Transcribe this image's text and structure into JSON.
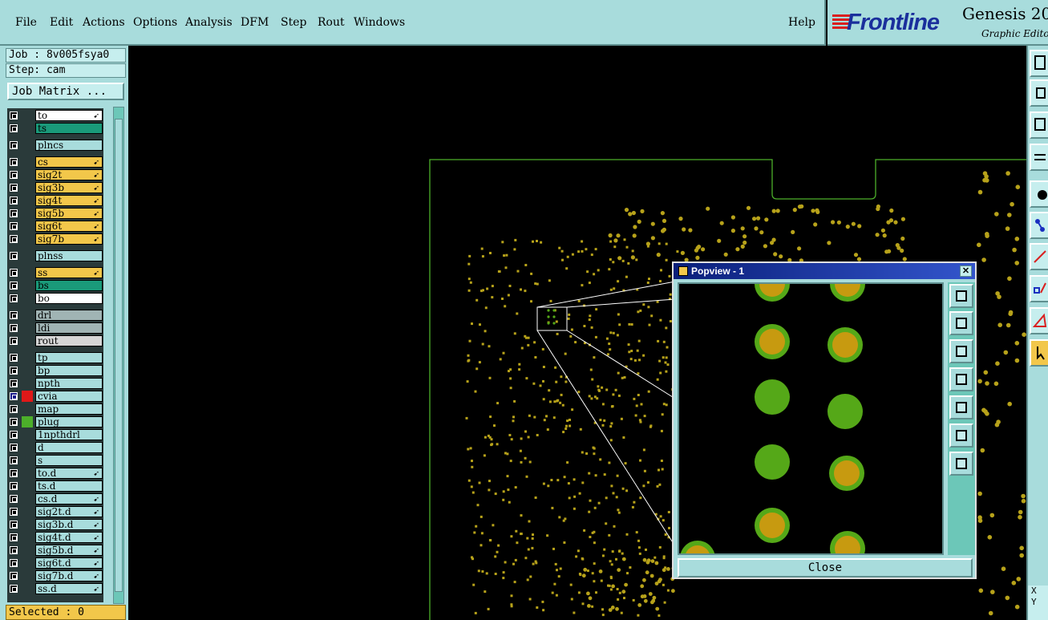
{
  "menu": [
    "File",
    "Edit",
    "Actions",
    "Options",
    "Analysis",
    "DFM",
    "Step",
    "Rout",
    "Windows"
  ],
  "help": "Help",
  "brand": {
    "name": "Frontline",
    "product": "Genesis 20",
    "subtitle": "Graphic Editor"
  },
  "job": "Job : 8v005fsya0",
  "step": "Step: cam",
  "job_matrix_label": "Job Matrix ...",
  "layers": [
    {
      "name": "to",
      "color": "#ffffff",
      "arrow": true
    },
    {
      "name": "ts",
      "color": "#1a9a7a",
      "arrow": false
    },
    {
      "name": "plncs",
      "color": "#a8dcdc",
      "arrow": false
    },
    {
      "name": "cs",
      "color": "#f2c74a",
      "arrow": true
    },
    {
      "name": "sig2t",
      "color": "#f2c74a",
      "arrow": true
    },
    {
      "name": "sig3b",
      "color": "#f2c74a",
      "arrow": true
    },
    {
      "name": "sig4t",
      "color": "#f2c74a",
      "arrow": true
    },
    {
      "name": "sig5b",
      "color": "#f2c74a",
      "arrow": true
    },
    {
      "name": "sig6t",
      "color": "#f2c74a",
      "arrow": true
    },
    {
      "name": "sig7b",
      "color": "#f2c74a",
      "arrow": true
    },
    {
      "name": "plnss",
      "color": "#a8dcdc",
      "arrow": false
    },
    {
      "name": "ss",
      "color": "#f2c74a",
      "arrow": true
    },
    {
      "name": "bs",
      "color": "#1a9a7a",
      "arrow": false
    },
    {
      "name": "bo",
      "color": "#ffffff",
      "arrow": false
    },
    {
      "name": "drl",
      "color": "#a0b4b4",
      "arrow": false
    },
    {
      "name": "ldi",
      "color": "#a0b4b4",
      "arrow": false
    },
    {
      "name": "rout",
      "color": "#d6d6d6",
      "arrow": false
    },
    {
      "name": "tp",
      "color": "#a8dcdc",
      "arrow": false
    },
    {
      "name": "bp",
      "color": "#a8dcdc",
      "arrow": false
    },
    {
      "name": "npth",
      "color": "#a8dcdc",
      "arrow": false
    },
    {
      "name": "cvia",
      "color": "#a8dcdc",
      "arrow": false
    },
    {
      "name": "map",
      "color": "#a8dcdc",
      "arrow": false
    },
    {
      "name": "plug",
      "color": "#a8dcdc",
      "arrow": false
    },
    {
      "name": "1npthdrl",
      "color": "#a8dcdc",
      "arrow": false
    },
    {
      "name": "d",
      "color": "#a8dcdc",
      "arrow": false
    },
    {
      "name": "s",
      "color": "#a8dcdc",
      "arrow": false
    },
    {
      "name": "to.d",
      "color": "#a8dcdc",
      "arrow": true
    },
    {
      "name": "ts.d",
      "color": "#a8dcdc",
      "arrow": false
    },
    {
      "name": "cs.d",
      "color": "#a8dcdc",
      "arrow": true
    },
    {
      "name": "sig2t.d",
      "color": "#a8dcdc",
      "arrow": true
    },
    {
      "name": "sig3b.d",
      "color": "#a8dcdc",
      "arrow": true
    },
    {
      "name": "sig4t.d",
      "color": "#a8dcdc",
      "arrow": true
    },
    {
      "name": "sig5b.d",
      "color": "#a8dcdc",
      "arrow": true
    },
    {
      "name": "sig6t.d",
      "color": "#a8dcdc",
      "arrow": true
    },
    {
      "name": "sig7b.d",
      "color": "#a8dcdc",
      "arrow": true
    },
    {
      "name": "ss.d",
      "color": "#a8dcdc",
      "arrow": true
    }
  ],
  "selected": "Selected : 0",
  "popview": {
    "title": "Popview - 1",
    "close_label": "Close"
  },
  "coords": {
    "x_label": "X",
    "y_label": "Y"
  },
  "colors": {
    "panel": "#a8dcdc",
    "pad_fill": "#c79a10",
    "pad_ring": "#55a818",
    "outline": "#4caf2a",
    "dots": "#b7a21a"
  }
}
